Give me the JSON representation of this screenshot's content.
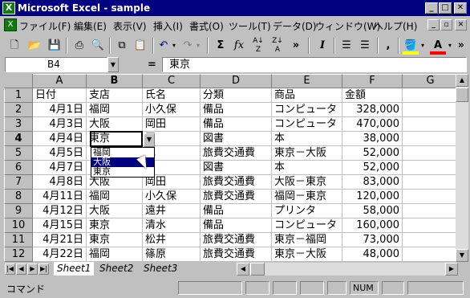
{
  "window": {
    "title": "Microsoft Excel - sample",
    "app_icon": "excel-icon",
    "controls": [
      "minimize-icon",
      "maximize-icon",
      "close-icon"
    ]
  },
  "menu": {
    "items": [
      "ファイル(F)",
      "編集(E)",
      "表示(V)",
      "挿入(I)",
      "書式(O)",
      "ツール(T)",
      "データ(D)",
      "ウィンドウ(W)",
      "ヘルプ(H)"
    ]
  },
  "toolbar": {
    "sigma": "Σ",
    "fx": "fx",
    "italic": "I",
    "comma": ",",
    "more": "»"
  },
  "formula_bar": {
    "name_box": "B4",
    "equals": "=",
    "value": "東京"
  },
  "sheet": {
    "columns": [
      "A",
      "B",
      "C",
      "D",
      "E",
      "F",
      "G"
    ],
    "active_column": "B",
    "active_row": "4",
    "rows": [
      {
        "num": "1",
        "cells": [
          "日付",
          "支店",
          "氏名",
          "分類",
          "商品",
          "金額",
          ""
        ]
      },
      {
        "num": "2",
        "cells": [
          "4月1日",
          "福岡",
          "小久保",
          "備品",
          "コンピュータ",
          "328,000",
          ""
        ]
      },
      {
        "num": "3",
        "cells": [
          "4月3日",
          "大阪",
          "岡田",
          "備品",
          "コンピュータ",
          "470,000",
          ""
        ]
      },
      {
        "num": "4",
        "cells": [
          "4月4日",
          "東京",
          "田",
          "図書",
          "本",
          "38,000",
          ""
        ]
      },
      {
        "num": "5",
        "cells": [
          "4月5日",
          "",
          "水",
          "旅費交通費",
          "東京－大阪",
          "52,000",
          ""
        ]
      },
      {
        "num": "6",
        "cells": [
          "4月7日",
          "",
          "原",
          "図書",
          "本",
          "52,000",
          ""
        ]
      },
      {
        "num": "7",
        "cells": [
          "4月8日",
          "大阪",
          "岡田",
          "旅費交通費",
          "大阪－東京",
          "83,000",
          ""
        ]
      },
      {
        "num": "8",
        "cells": [
          "4月11日",
          "福岡",
          "小久保",
          "旅費交通費",
          "福岡－東京",
          "120,000",
          ""
        ]
      },
      {
        "num": "9",
        "cells": [
          "4月12日",
          "大阪",
          "遠井",
          "備品",
          "プリンタ",
          "58,000",
          ""
        ]
      },
      {
        "num": "10",
        "cells": [
          "4月15日",
          "東京",
          "清水",
          "備品",
          "コンピュータ",
          "160,000",
          ""
        ]
      },
      {
        "num": "11",
        "cells": [
          "4月21日",
          "東京",
          "松井",
          "旅費交通費",
          "東京－福岡",
          "73,000",
          ""
        ]
      },
      {
        "num": "12",
        "cells": [
          "4月22日",
          "福岡",
          "篠原",
          "旅費交通費",
          "東京－大阪",
          "48,000",
          ""
        ]
      }
    ],
    "dropdown": {
      "options": [
        "福岡",
        "大阪",
        "東京"
      ],
      "selected": "大阪"
    }
  },
  "tabs": {
    "sheets": [
      "Sheet1",
      "Sheet2",
      "Sheet3"
    ],
    "active": "Sheet1"
  },
  "status": {
    "mode": "コマンド",
    "indicator": "NUM"
  },
  "colors": {
    "title_bar": "#000080",
    "chrome": "#c0c0c0",
    "selection": "#000080"
  }
}
